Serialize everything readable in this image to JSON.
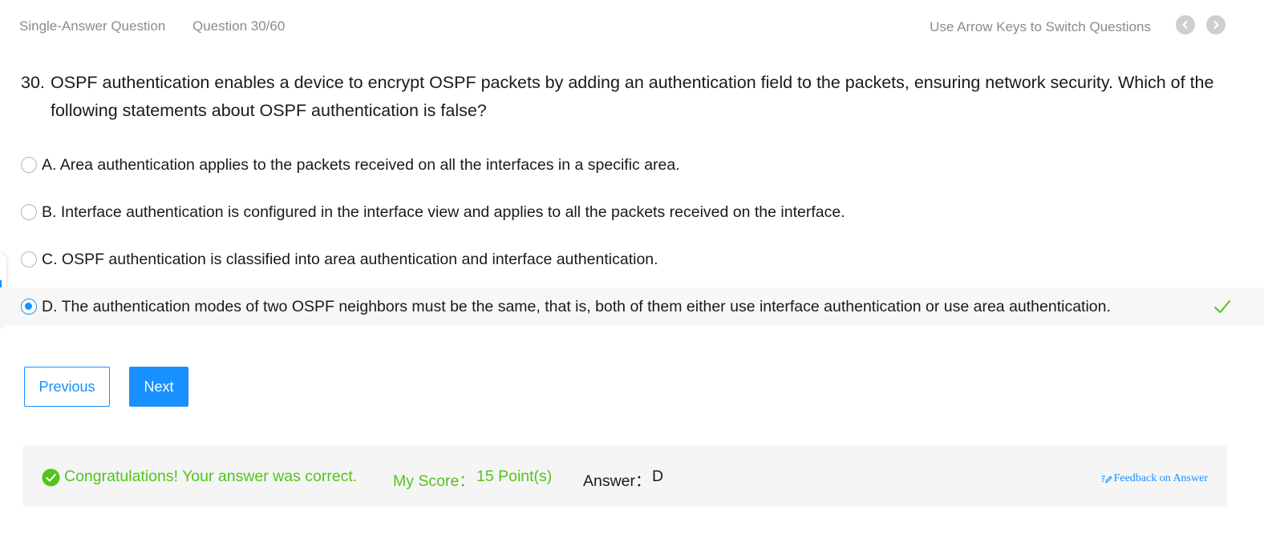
{
  "header": {
    "question_type": "Single-Answer Question",
    "question_counter": "Question 30/60",
    "nav_hint": "Use Arrow Keys to Switch Questions"
  },
  "question": {
    "number": "30.",
    "text": "OSPF authentication enables a device to encrypt OSPF packets by adding an authentication field to the packets, ensuring network security. Which of the following statements about OSPF authentication is false?"
  },
  "options": [
    {
      "text": "A. Area authentication applies to the packets received on all the interfaces in a specific area.",
      "selected": false
    },
    {
      "text": "B. Interface authentication is configured in the interface view and applies to all the packets received on the interface.",
      "selected": false
    },
    {
      "text": "C. OSPF authentication is classified into area authentication and interface authentication.",
      "selected": false
    },
    {
      "text": "D. The authentication modes of two OSPF neighbors must be the same, that is, both of them either use interface authentication or use area authentication.",
      "selected": true
    }
  ],
  "buttons": {
    "previous": "Previous",
    "next": "Next"
  },
  "result": {
    "message": "Congratulations! Your answer was correct.",
    "score_label": "My Score：",
    "score_value": "15 Point(s)",
    "answer_label": "Answer：",
    "answer_value": "D",
    "feedback_link": "Feedback on Answer"
  },
  "colors": {
    "accent": "#1890ff",
    "success": "#52c41a",
    "muted_text": "#8c8c8c"
  },
  "icons": {
    "prev_question": "chevron-left-icon",
    "next_question": "chevron-right-icon",
    "correct_option": "check-icon",
    "result_status": "check-circle-icon",
    "feedback": "edit-icon"
  }
}
